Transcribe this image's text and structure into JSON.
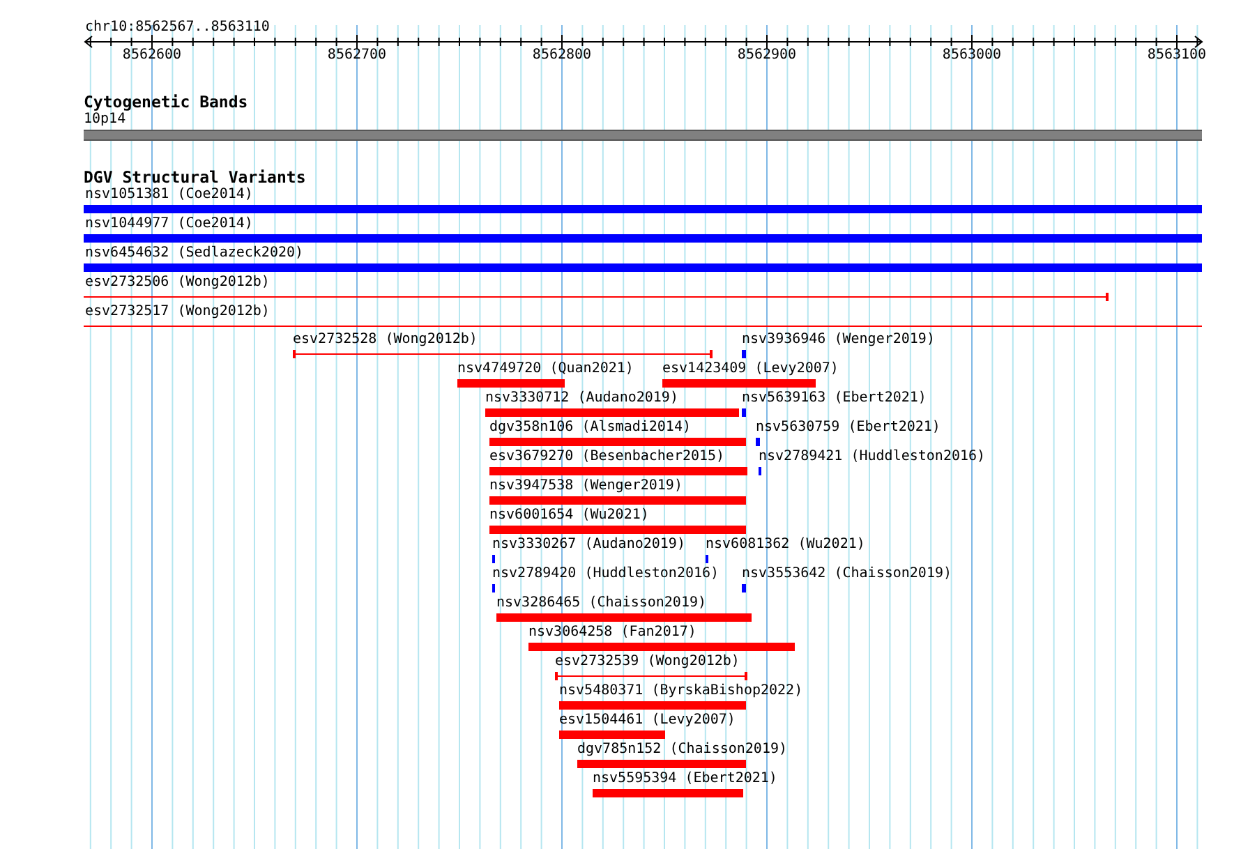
{
  "ruler": {
    "location": "chr10:8562567..8563110",
    "ticks": [
      "8562600",
      "8562700",
      "8562800",
      "8562900",
      "8563000",
      "8563100"
    ]
  },
  "cytogenetic_bands": {
    "title": "Cytogenetic Bands",
    "band": "10p14"
  },
  "dgv_structural_variants": {
    "title": "DGV Structural Variants",
    "full_rows": [
      {
        "label": "nsv1051381 (Coe2014)",
        "kind": "bar",
        "color": "#0000ff"
      },
      {
        "label": "nsv1044977 (Coe2014)",
        "kind": "bar",
        "color": "#0000ff"
      },
      {
        "label": "nsv6454632 (Sedlazeck2020)",
        "kind": "bar",
        "color": "#0000ff"
      },
      {
        "label": "esv2732506 (Wong2012b)",
        "kind": "span",
        "color": "#ff0000"
      },
      {
        "label": "esv2732517 (Wong2012b)",
        "kind": "span",
        "color": "#ff0000"
      }
    ],
    "packed_rows": [
      {
        "features": [
          {
            "label": "esv2732528 (Wong2012b)",
            "kind": "span",
            "color": "#ff0000"
          },
          {
            "label": "nsv3936946 (Wenger2019)",
            "kind": "bar",
            "color": "#0000ff"
          }
        ]
      },
      {
        "features": [
          {
            "label": "nsv4749720 (Quan2021)",
            "kind": "bar",
            "color": "#ff0000"
          },
          {
            "label": "esv1423409 (Levy2007)",
            "kind": "bar",
            "color": "#ff0000"
          }
        ]
      },
      {
        "features": [
          {
            "label": "nsv3330712 (Audano2019)",
            "kind": "bar",
            "color": "#ff0000"
          },
          {
            "label": "nsv5639163 (Ebert2021)",
            "kind": "bar",
            "color": "#0000ff"
          }
        ]
      },
      {
        "features": [
          {
            "label": "dgv358n106 (Alsmadi2014)",
            "kind": "bar",
            "color": "#ff0000"
          },
          {
            "label": "nsv5630759 (Ebert2021)",
            "kind": "bar",
            "color": "#0000ff"
          }
        ]
      },
      {
        "features": [
          {
            "label": "esv3679270 (Besenbacher2015)",
            "kind": "bar",
            "color": "#ff0000"
          },
          {
            "label": "nsv2789421 (Huddleston2016)",
            "kind": "bar",
            "color": "#0000ff"
          }
        ]
      },
      {
        "features": [
          {
            "label": "nsv3947538 (Wenger2019)",
            "kind": "bar",
            "color": "#ff0000"
          }
        ]
      },
      {
        "features": [
          {
            "label": "nsv6001654 (Wu2021)",
            "kind": "bar",
            "color": "#ff0000"
          }
        ]
      },
      {
        "features": [
          {
            "label": "nsv3330267 (Audano2019)",
            "kind": "bar",
            "color": "#0000ff"
          },
          {
            "label": "nsv6081362 (Wu2021)",
            "kind": "bar",
            "color": "#0000ff"
          }
        ]
      },
      {
        "features": [
          {
            "label": "nsv2789420 (Huddleston2016)",
            "kind": "bar",
            "color": "#0000ff"
          },
          {
            "label": "nsv3553642 (Chaisson2019)",
            "kind": "bar",
            "color": "#0000ff"
          }
        ]
      },
      {
        "features": [
          {
            "label": "nsv3286465 (Chaisson2019)",
            "kind": "bar",
            "color": "#ff0000"
          }
        ]
      },
      {
        "features": [
          {
            "label": "nsv3064258 (Fan2017)",
            "kind": "bar",
            "color": "#ff0000"
          }
        ]
      },
      {
        "features": [
          {
            "label": "esv2732539 (Wong2012b)",
            "kind": "span",
            "color": "#ff0000"
          }
        ]
      },
      {
        "features": [
          {
            "label": "nsv5480371 (ByrskaBishop2022)",
            "kind": "bar",
            "color": "#ff0000"
          }
        ]
      },
      {
        "features": [
          {
            "label": "esv1504461 (Levy2007)",
            "kind": "bar",
            "color": "#ff0000"
          }
        ]
      },
      {
        "features": [
          {
            "label": "dgv785n152 (Chaisson2019)",
            "kind": "bar",
            "color": "#ff0000"
          }
        ]
      },
      {
        "features": [
          {
            "label": "nsv5595394 (Ebert2021)",
            "kind": "bar",
            "color": "#ff0000"
          }
        ]
      }
    ]
  }
}
